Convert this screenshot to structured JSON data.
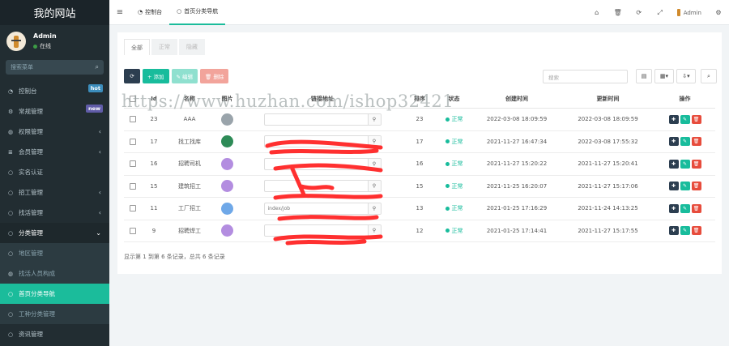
{
  "sidebar": {
    "site_title": "我的网站",
    "user": {
      "name": "Admin",
      "status": "在线"
    },
    "search_placeholder": "搜索菜单",
    "items": [
      {
        "icon": "dashboard-icon",
        "glyph": "◔",
        "label": "控制台",
        "badge": "hot",
        "badge_color": "#3c8dbc",
        "state": "normal"
      },
      {
        "icon": "cogs-icon",
        "glyph": "⚙",
        "label": "常规管理",
        "badge": "new",
        "badge_color": "#605ca8",
        "state": "normal"
      },
      {
        "icon": "group-icon",
        "glyph": "◍",
        "label": "权限管理",
        "arrow": "‹",
        "state": "normal"
      },
      {
        "icon": "list-icon",
        "glyph": "≣",
        "label": "会员管理",
        "arrow": "‹",
        "state": "normal"
      },
      {
        "icon": "circle-icon",
        "glyph": "○",
        "label": "实名认证",
        "state": "normal"
      },
      {
        "icon": "circle-icon",
        "glyph": "○",
        "label": "招工管理",
        "arrow": "‹",
        "state": "normal"
      },
      {
        "icon": "circle-icon",
        "glyph": "○",
        "label": "找活管理",
        "arrow": "‹",
        "state": "normal"
      },
      {
        "icon": "circle-icon",
        "glyph": "○",
        "label": "分类管理",
        "arrow": "⌄",
        "state": "open"
      },
      {
        "icon": "circle-icon",
        "glyph": "○",
        "label": "地区管理",
        "state": "sub"
      },
      {
        "icon": "group-icon",
        "glyph": "◍",
        "label": "找活人员构成",
        "state": "sub"
      },
      {
        "icon": "circle-icon",
        "glyph": "○",
        "label": "首页分类导航",
        "state": "active"
      },
      {
        "icon": "circle-icon",
        "glyph": "○",
        "label": "工种分类管理",
        "state": "sub"
      },
      {
        "icon": "circle-icon",
        "glyph": "○",
        "label": "资讯管理",
        "state": "normal"
      }
    ]
  },
  "topbar": {
    "tabs": [
      {
        "icon": "dashboard-icon",
        "glyph": "◔",
        "label": "控制台"
      },
      {
        "icon": "circle-icon",
        "glyph": "○",
        "label": "首页分类导航"
      }
    ],
    "user_name": "Admin"
  },
  "panel": {
    "tabs": [
      "全部",
      "正常",
      "隐藏"
    ],
    "buttons": {
      "refresh": "⟳",
      "add": "+ 添加",
      "edit": "✎ 编辑",
      "delete": "🗑 删除"
    },
    "search_placeholder": "搜索",
    "columns": {
      "id": "Id",
      "name": "名称",
      "image": "图片",
      "link": "链接地址",
      "sort": "排序",
      "status": "状态",
      "created": "创建时间",
      "updated": "更新时间",
      "ops": "操作"
    },
    "rows": [
      {
        "id": "23",
        "name": "AAA",
        "img_color": "#9aa4ab",
        "link": "",
        "sort": "23",
        "status": "正常",
        "created": "2022-03-08 18:09:59",
        "updated": "2022-03-08 18:09:59"
      },
      {
        "id": "17",
        "name": "找工找库",
        "img_color": "#2e8b57",
        "link": "",
        "sort": "17",
        "status": "正常",
        "created": "2021-11-27 16:47:34",
        "updated": "2022-03-08 17:55:32"
      },
      {
        "id": "16",
        "name": "招聘司机",
        "img_color": "#b38de0",
        "link": "",
        "sort": "16",
        "status": "正常",
        "created": "2021-11-27 15:20:22",
        "updated": "2021-11-27 15:20:41"
      },
      {
        "id": "15",
        "name": "建筑招工",
        "img_color": "#b38de0",
        "link": "",
        "sort": "15",
        "status": "正常",
        "created": "2021-11-25 16:20:07",
        "updated": "2021-11-27 15:17:06"
      },
      {
        "id": "11",
        "name": "工厂招工",
        "img_color": "#6fa8e8",
        "link": "index/job",
        "sort": "13",
        "status": "正常",
        "created": "2021-01-25 17:16:29",
        "updated": "2021-11-24 14:13:25"
      },
      {
        "id": "9",
        "name": "招聘焊工",
        "img_color": "#b38de0",
        "link": "",
        "sort": "12",
        "status": "正常",
        "created": "2021-01-25 17:14:41",
        "updated": "2021-11-27 15:17:55"
      }
    ],
    "footer": "显示第 1 到第 6 条记录，总共 6 条记录"
  },
  "watermark": "https://www.huzhan.com/ishop32421"
}
